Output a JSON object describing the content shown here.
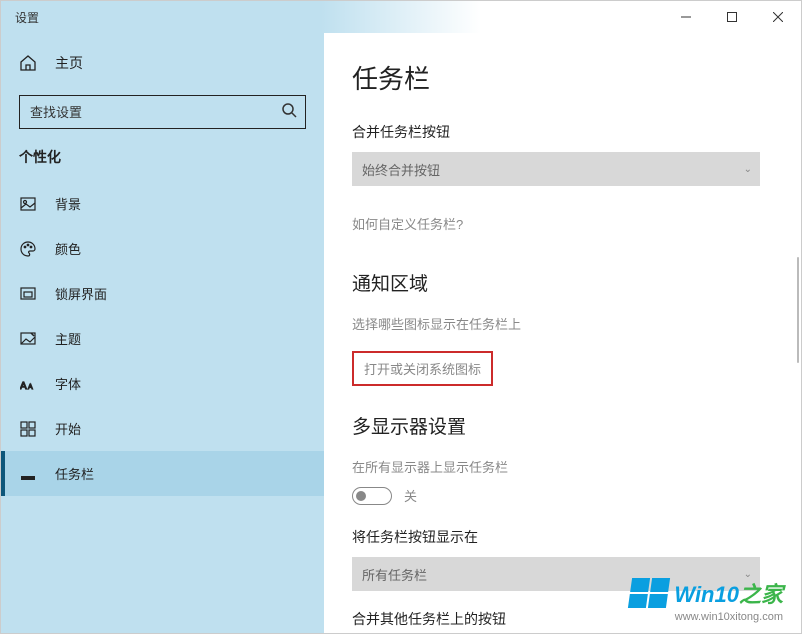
{
  "window": {
    "title": "设置"
  },
  "sidebar": {
    "home": "主页",
    "search_placeholder": "查找设置",
    "section": "个性化",
    "items": [
      {
        "label": "背景"
      },
      {
        "label": "颜色"
      },
      {
        "label": "锁屏界面"
      },
      {
        "label": "主题"
      },
      {
        "label": "字体"
      },
      {
        "label": "开始"
      },
      {
        "label": "任务栏"
      }
    ]
  },
  "page": {
    "title": "任务栏",
    "combine_label": "合并任务栏按钮",
    "combine_value": "始终合并按钮",
    "customize_link": "如何自定义任务栏?",
    "notification_area": {
      "head": "通知区域",
      "link1": "选择哪些图标显示在任务栏上",
      "link2": "打开或关闭系统图标"
    },
    "multi_display": {
      "head": "多显示器设置",
      "show_on_all": "在所有显示器上显示任务栏",
      "toggle_off": "关",
      "show_buttons_label": "将任务栏按钮显示在",
      "show_buttons_value": "所有任务栏",
      "combine_other": "合并其他任务栏上的按钮"
    }
  },
  "watermark": {
    "brand_a": "Win",
    "brand_b": "10",
    "brand_c": "之家",
    "url": "www.win10xitong.com"
  }
}
